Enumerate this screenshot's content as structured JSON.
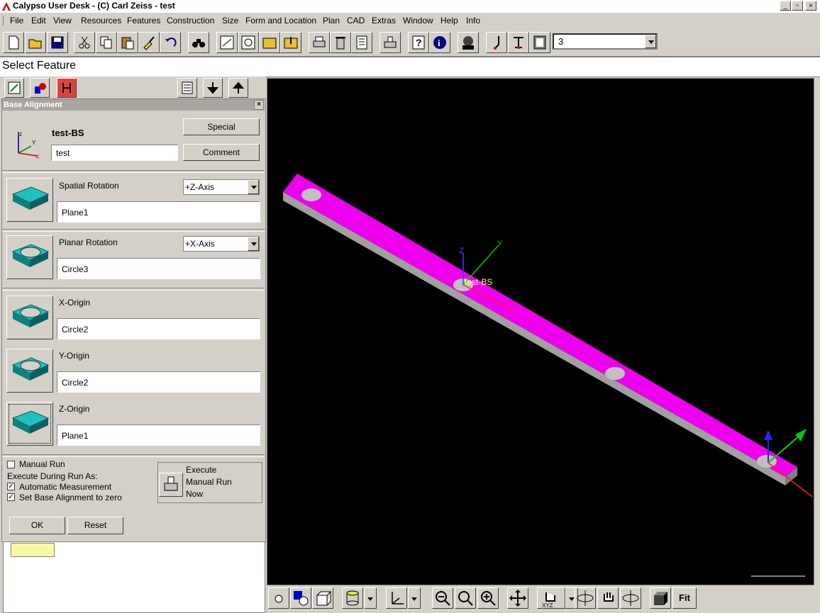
{
  "window": {
    "title": "Calypso User Desk - (C) Carl Zeiss - test"
  },
  "menu": [
    "File",
    "Edit",
    "View",
    "Resources",
    "Features",
    "Construction",
    "Size",
    "Form and Location",
    "Plan",
    "CAD",
    "Extras",
    "Window",
    "Help",
    "Info"
  ],
  "toolbar": {
    "combo_value": "3"
  },
  "header": {
    "title": "Select Feature"
  },
  "dialog": {
    "title": "Base Alignment",
    "name": "test-BS",
    "comment_value": "test",
    "special_label": "Special",
    "comment_label": "Comment",
    "sections": [
      {
        "label": "Spatial Rotation",
        "axis": "+Z-Axis",
        "feature": "Plane1",
        "icon": "plane-icon"
      },
      {
        "label": "Planar Rotation",
        "axis": "+X-Axis",
        "feature": "Circle3",
        "icon": "circle-icon"
      },
      {
        "label": "X-Origin",
        "feature": "Circle2",
        "icon": "circle-icon"
      },
      {
        "label": "Y-Origin",
        "feature": "Circle2",
        "icon": "circle-icon"
      },
      {
        "label": "Z-Origin",
        "feature": "Plane1",
        "icon": "plane-icon"
      }
    ],
    "manual_run": "Manual Run",
    "execute_as": "Execute During Run As:",
    "auto_measure": "Automatic Measurement",
    "set_zero": "Set Base Alignment to zero",
    "execute_line1": "Execute",
    "execute_line2": "Manual Run",
    "execute_line3": "Now",
    "ok": "OK",
    "reset": "Reset"
  },
  "graphics": {
    "label": "test-BS",
    "axis_x": "X",
    "axis_y": "Y",
    "axis_z": "Z",
    "axis_z2": "Z",
    "part_color": "#ee00ee"
  },
  "bottom": {
    "fit_label": "Fit"
  }
}
